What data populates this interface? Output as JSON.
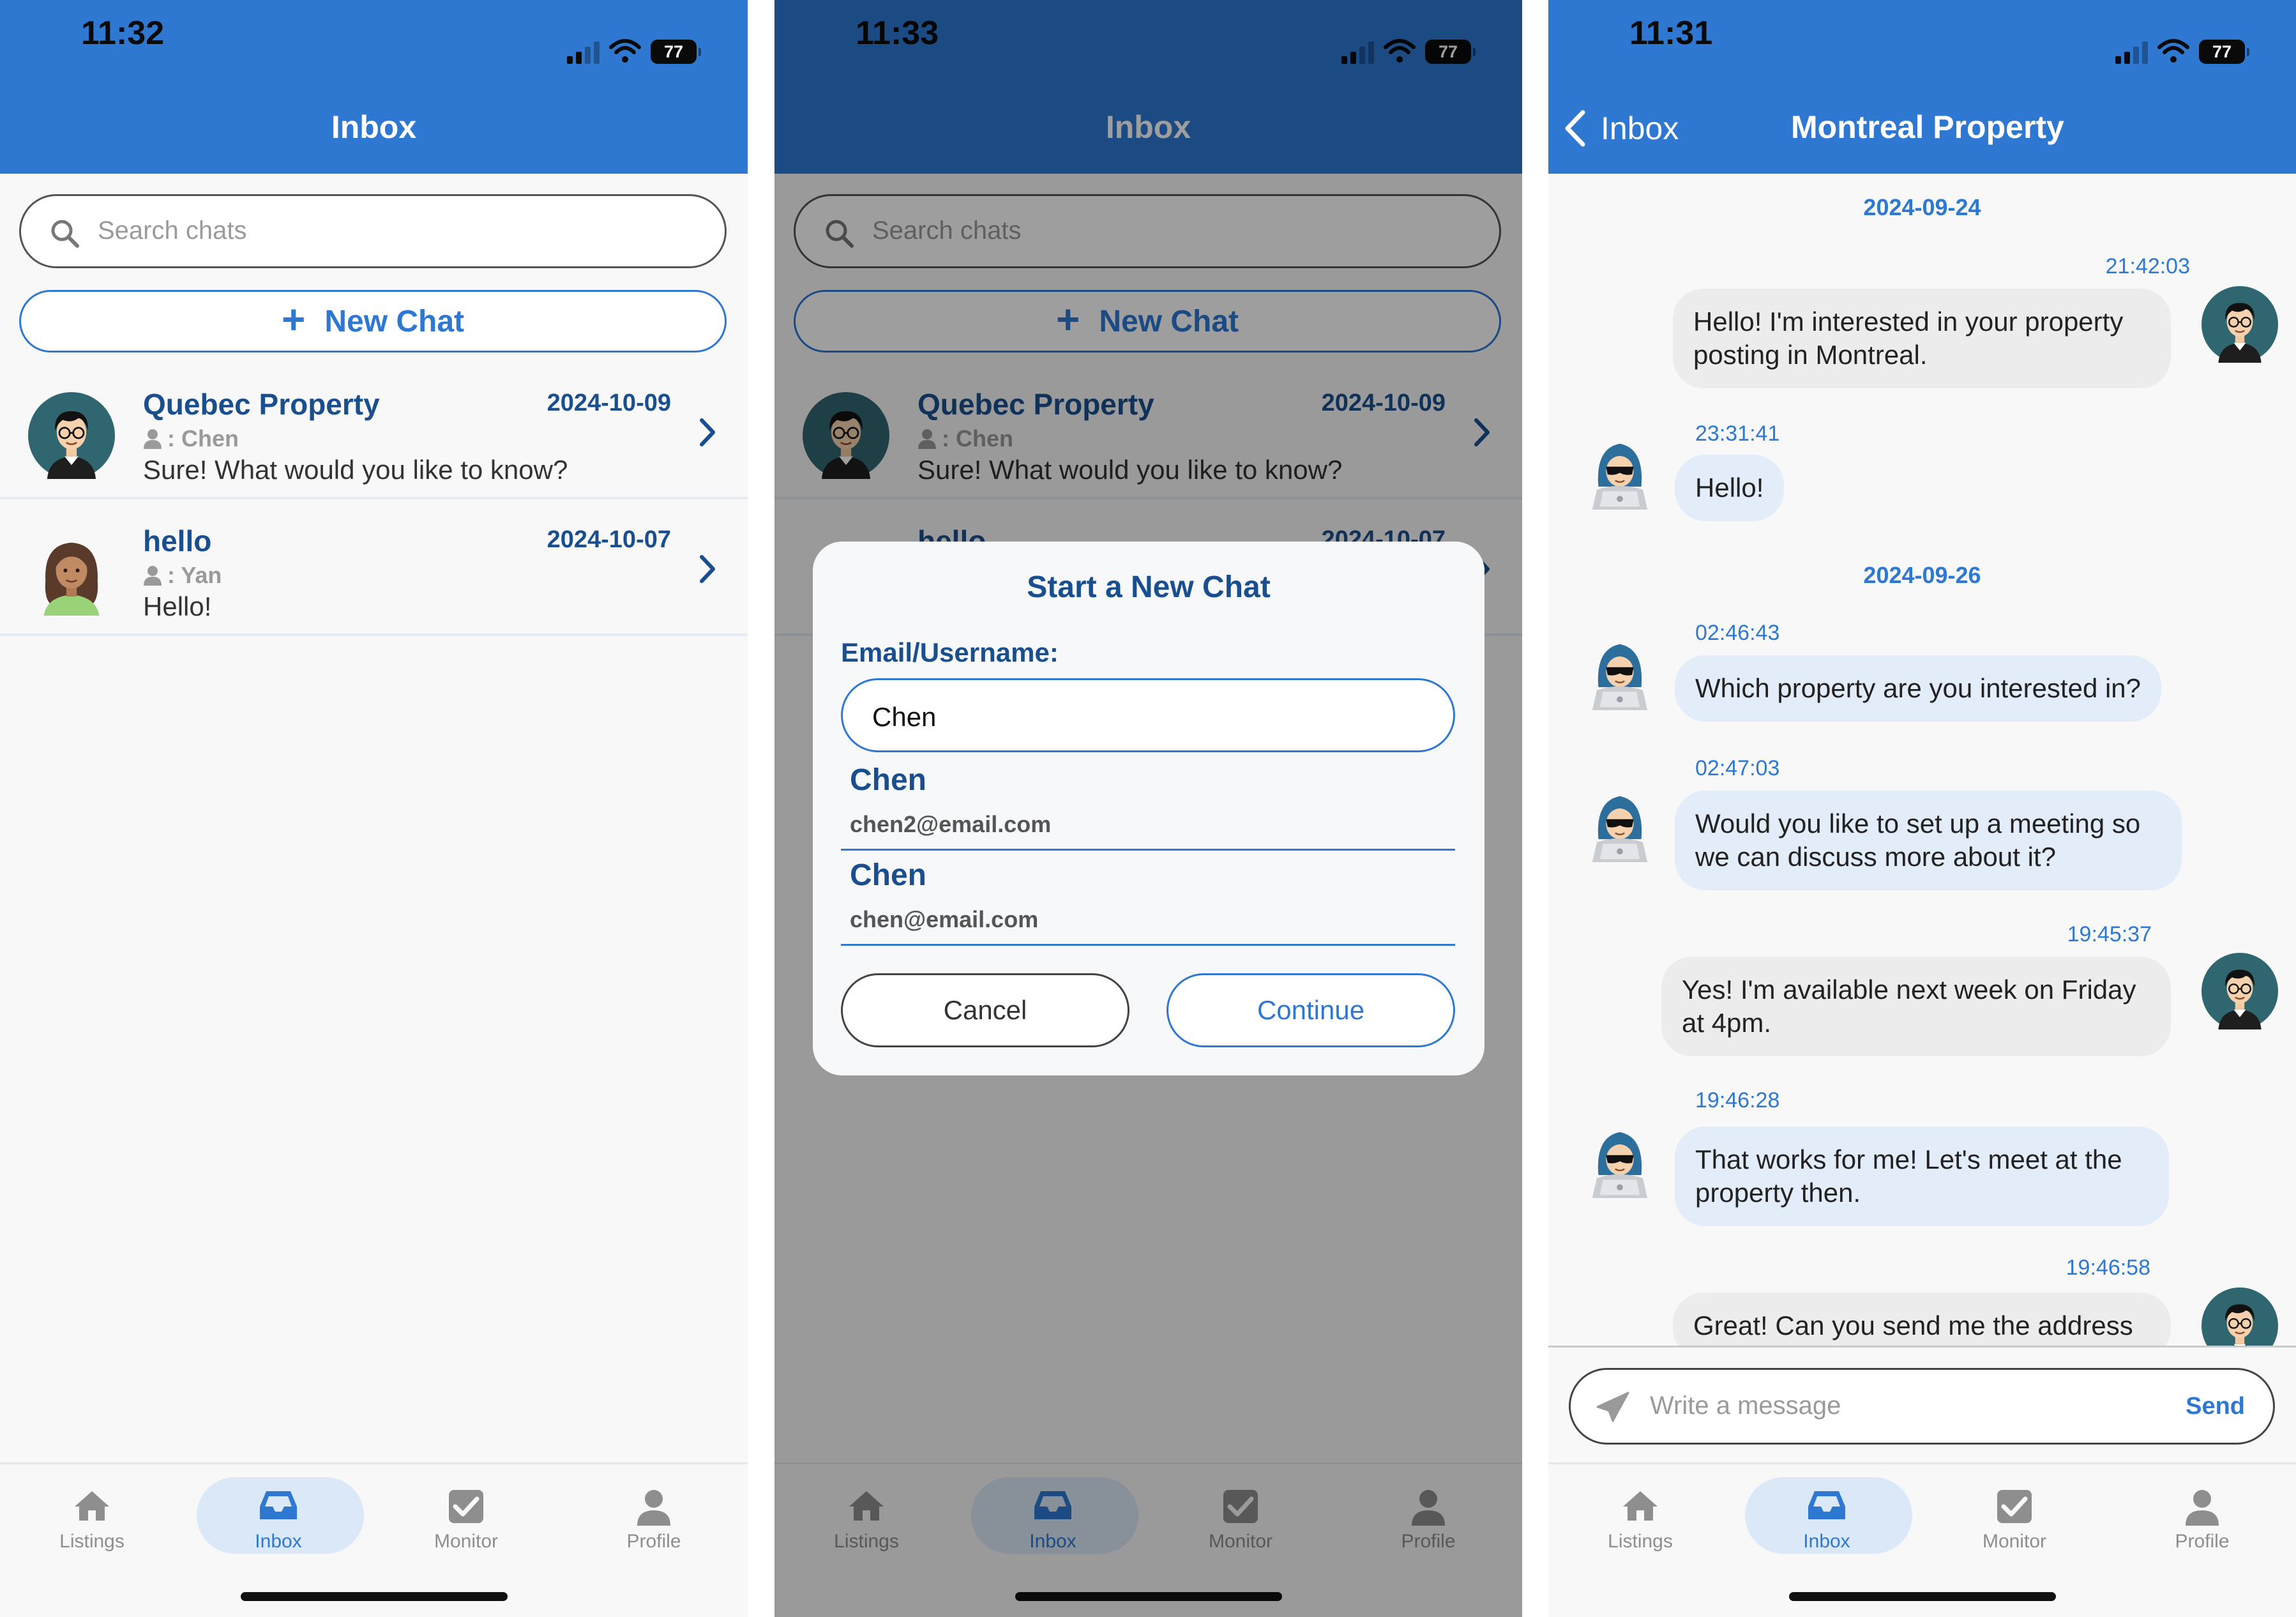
{
  "colors": {
    "primary": "#2e78d2",
    "title_blue": "#1a4f8f",
    "tab_active_bg": "#dbe8f8",
    "my_bubble": "#ececec",
    "their_bubble": "#e3ecf9"
  },
  "screen1": {
    "time": "11:32",
    "battery": "77",
    "title": "Inbox",
    "search_placeholder": "Search chats",
    "new_chat_label": "New Chat",
    "chats": [
      {
        "title": "Quebec Property",
        "date": "2024-10-09",
        "user": ": Chen",
        "message": "Sure! What would you like to know?",
        "avatar": "man-glasses-avatar"
      },
      {
        "title": "hello",
        "date": "2024-10-07",
        "user": ": Yan",
        "message": "Hello!",
        "avatar": "woman-avatar"
      }
    ]
  },
  "screen2": {
    "time": "11:33",
    "battery": "77",
    "title": "Inbox",
    "search_placeholder": "Search chats",
    "new_chat_label": "New Chat",
    "chats": [
      {
        "title": "Quebec Property",
        "date": "2024-10-09",
        "user": ": Chen",
        "message": "Sure! What would you like to know?"
      },
      {
        "title": "hello",
        "date": "2024-10-07"
      }
    ],
    "modal": {
      "title": "Start a New Chat",
      "field_label": "Email/Username:",
      "input_value": "Chen",
      "suggestions": [
        {
          "name": "Chen",
          "email": "chen2@email.com"
        },
        {
          "name": "Chen",
          "email": "chen@email.com"
        }
      ],
      "cancel_label": "Cancel",
      "continue_label": "Continue"
    }
  },
  "screen3": {
    "time": "11:31",
    "battery": "77",
    "back_label": "Inbox",
    "title": "Montreal Property",
    "dates": [
      "2024-09-24",
      "2024-09-26"
    ],
    "messages": [
      {
        "time": "21:42:03",
        "text": "Hello! I'm interested in your property posting in Montreal.",
        "from": "me"
      },
      {
        "time": "23:31:41",
        "text": "Hello!",
        "from": "them"
      },
      {
        "time": "02:46:43",
        "text": "Which property are you interested in?",
        "from": "them"
      },
      {
        "time": "02:47:03",
        "text": "Would you like to set up a meeting so we can discuss more about it?",
        "from": "them"
      },
      {
        "time": "19:45:37",
        "text": "Yes! I'm available next week on Friday at 4pm.",
        "from": "me"
      },
      {
        "time": "19:46:28",
        "text": "That works for me! Let's meet at the property then.",
        "from": "them"
      },
      {
        "time": "19:46:58",
        "text": "Great! Can you send me the address",
        "from": "me"
      }
    ],
    "composer_placeholder": "Write a message",
    "send_label": "Send"
  },
  "tabs": [
    {
      "label": "Listings",
      "icon": "home-icon"
    },
    {
      "label": "Inbox",
      "icon": "inbox-icon"
    },
    {
      "label": "Monitor",
      "icon": "checkbox-icon"
    },
    {
      "label": "Profile",
      "icon": "person-icon"
    }
  ],
  "active_tab": "Inbox"
}
